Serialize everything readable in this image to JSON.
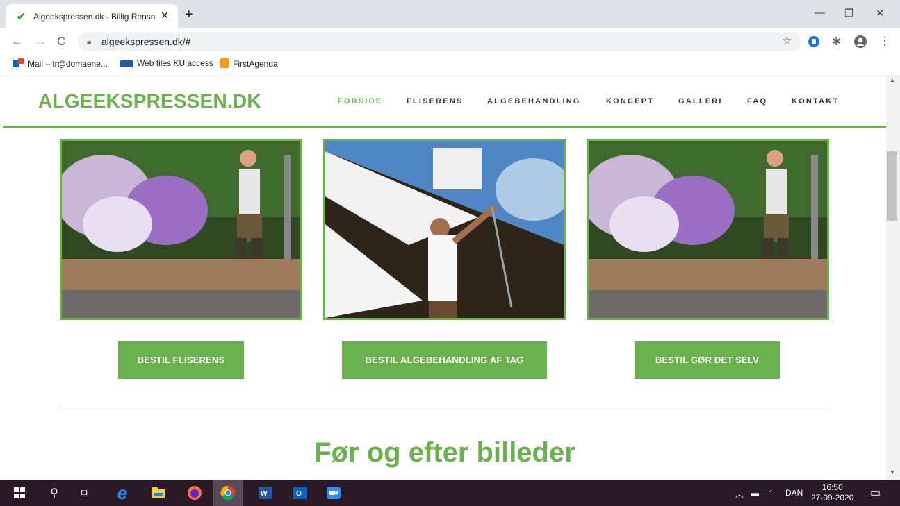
{
  "browser": {
    "tab_title": "Algeekspressen.dk - Billig Rensning",
    "tab_close": "✕",
    "new_tab": "+",
    "url": "algeekspressen.dk/#",
    "bookmarks": [
      {
        "label": "Mail – tr@domaene..."
      },
      {
        "label": "Web files KU access"
      },
      {
        "label": "FirstAgenda"
      }
    ]
  },
  "site": {
    "logo": "ALGEEKSPRESSEN.DK",
    "nav": [
      "FORSIDE",
      "FLISERENS",
      "ALGEBEHANDLING",
      "KONCEPT",
      "GALLERI",
      "FAQ",
      "KONTAKT"
    ],
    "active_nav": "FORSIDE",
    "buttons": [
      "BESTIL FLISERENS",
      "BESTIL ALGEBEHANDLING AF TAG",
      "BESTIL GØR DET SELV"
    ],
    "section_title": "Før og efter billeder",
    "accent_color": "#6ab04c"
  },
  "taskbar": {
    "language": "DAN",
    "time": "16:50",
    "date": "27-09-2020"
  }
}
